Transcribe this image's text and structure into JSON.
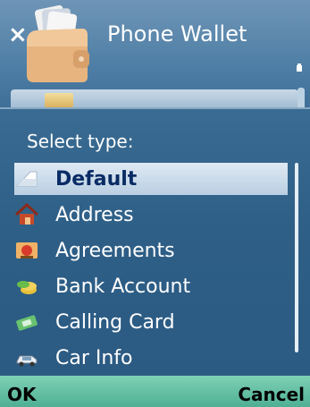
{
  "window": {
    "title": "Phone Wallet",
    "close_glyph": "×"
  },
  "dialog": {
    "title": "Select type:",
    "items": [
      {
        "label": "Default",
        "icon": "default-card-icon",
        "selected": true
      },
      {
        "label": "Address",
        "icon": "house-icon",
        "selected": false
      },
      {
        "label": "Agreements",
        "icon": "agreements-icon",
        "selected": false
      },
      {
        "label": "Bank Account",
        "icon": "coins-icon",
        "selected": false
      },
      {
        "label": "Calling Card",
        "icon": "phone-card-icon",
        "selected": false
      },
      {
        "label": "Car Info",
        "icon": "car-icon",
        "selected": false
      }
    ]
  },
  "softkeys": {
    "left": "OK",
    "right": "Cancel"
  },
  "colors": {
    "background_top": "#6f95b6",
    "popup": "#2e5f87",
    "selection": "#dfe9f3",
    "softkey_bar": "#7ed0b5"
  }
}
